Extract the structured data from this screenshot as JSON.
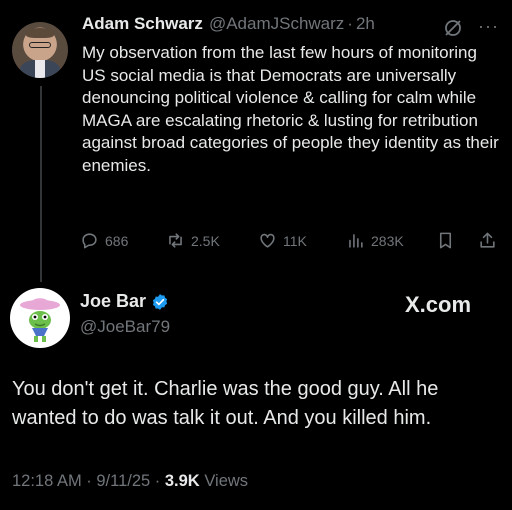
{
  "quoted_tweet": {
    "author_name": "Adam Schwarz",
    "handle": "@AdamJSchwarz",
    "separator": "·",
    "time": "2h",
    "text": "My observation from the last few hours of monitoring US social media is that Democrats are universally denouncing political violence & calling for calm while MAGA are escalating rhetoric & lusting for retribution against broad categories of people they identity as their enemies.",
    "more_label": "···",
    "actions": {
      "replies": "686",
      "reposts": "2.5K",
      "likes": "11K",
      "views": "283K"
    }
  },
  "reply_tweet": {
    "author_name": "Joe Bar",
    "handle": "@JoeBar79",
    "watermark": "X.com",
    "text": "You don't get it.  Charlie was the good guy.  All he wanted to do was talk it out.  And you killed him.",
    "timestamp": "12:18 AM · 9/11/25 · ",
    "views_count": "3.9K",
    "views_label": " Views"
  },
  "colors": {
    "background": "#000000",
    "text_primary": "#e7e9ea",
    "text_secondary": "#71767b",
    "verified_blue": "#1d9bf0",
    "thread_line": "#333639"
  },
  "icons": [
    "grok-icon",
    "more-icon",
    "reply-icon",
    "repost-icon",
    "like-icon",
    "views-icon",
    "bookmark-icon",
    "share-icon",
    "verified-badge-icon"
  ]
}
